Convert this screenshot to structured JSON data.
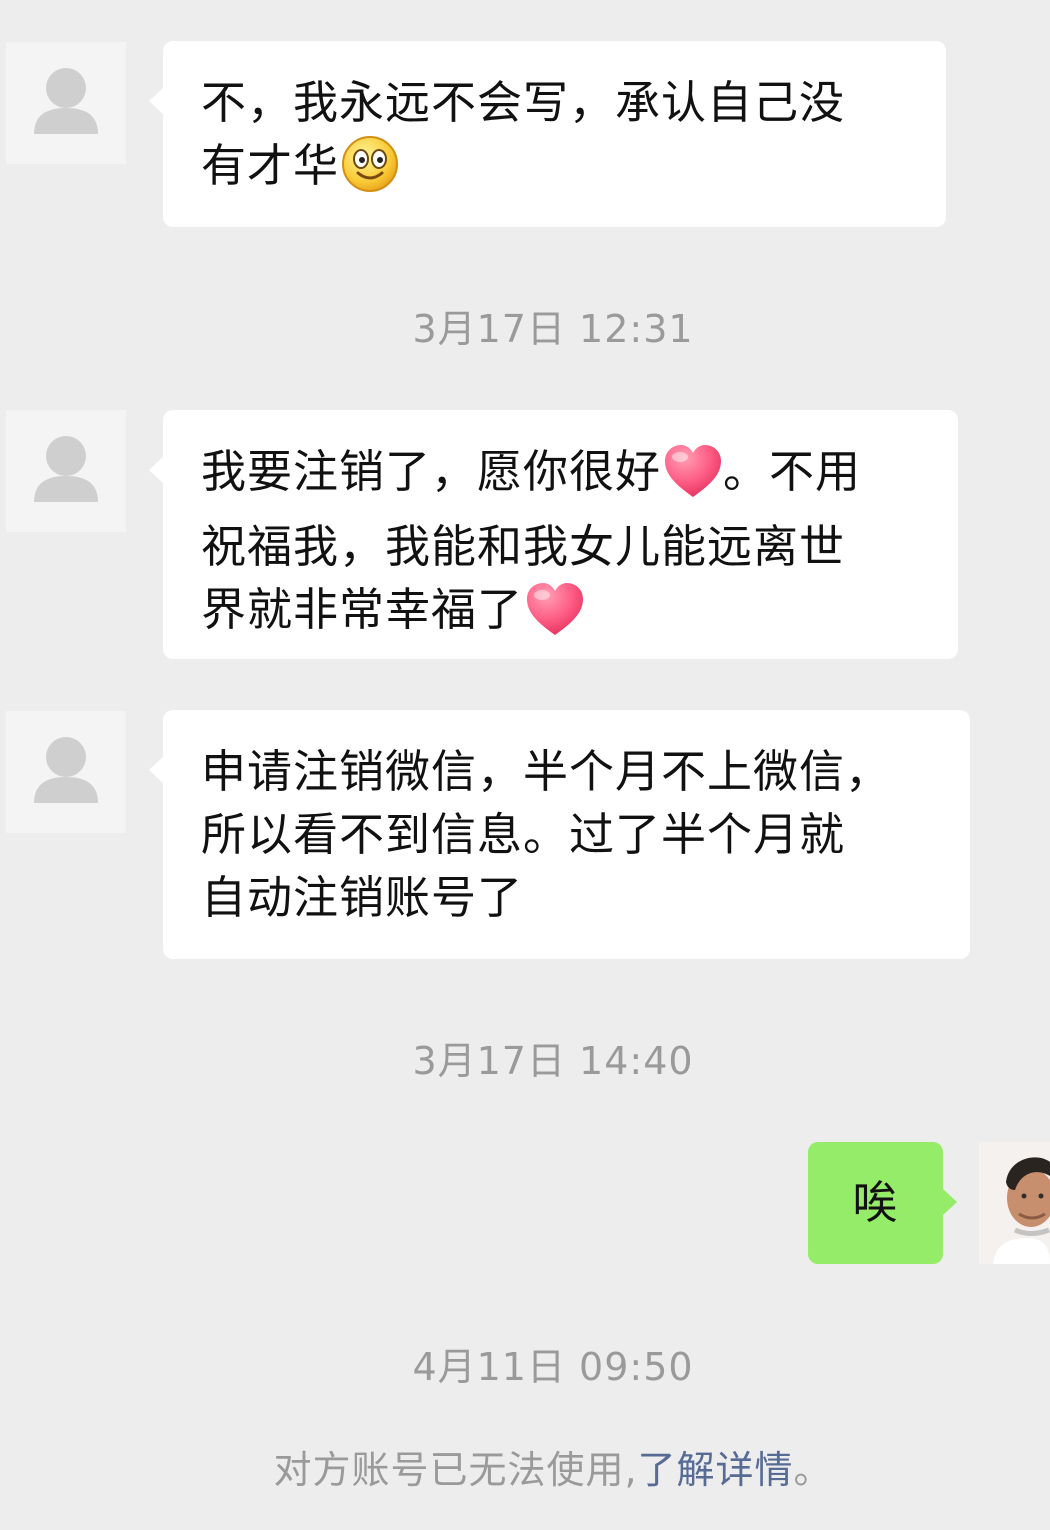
{
  "messages": [
    {
      "sender": "contact",
      "lines": [
        "不，我永远不会写，承认自己没",
        "有才华"
      ],
      "emoji": "smile-emoji-icon"
    },
    {
      "timestamp": "3月17日 12:31"
    },
    {
      "sender": "contact",
      "lines": [
        "我要注销了，愿你很好",
        "。不用",
        "祝福我，我能和我女儿能远离世",
        "界就非常幸福了"
      ],
      "emoji": "heart-emoji-icon"
    },
    {
      "sender": "contact",
      "lines": [
        "申请注销微信，半个月不上微信，",
        "所以看不到信息。过了半个月就",
        "自动注销账号了"
      ]
    },
    {
      "timestamp": "3月17日 14:40"
    },
    {
      "sender": "self",
      "lines": [
        "唉"
      ]
    },
    {
      "timestamp": "4月11日 09:50"
    }
  ],
  "notice": {
    "text": "对方账号已无法使用,",
    "link": "了解详情",
    "end": "。"
  },
  "colors": {
    "background": "#ededed",
    "incoming_bubble": "#ffffff",
    "outgoing_bubble": "#95ec69",
    "timestamp": "#9a9a9a",
    "link": "#576b95"
  }
}
